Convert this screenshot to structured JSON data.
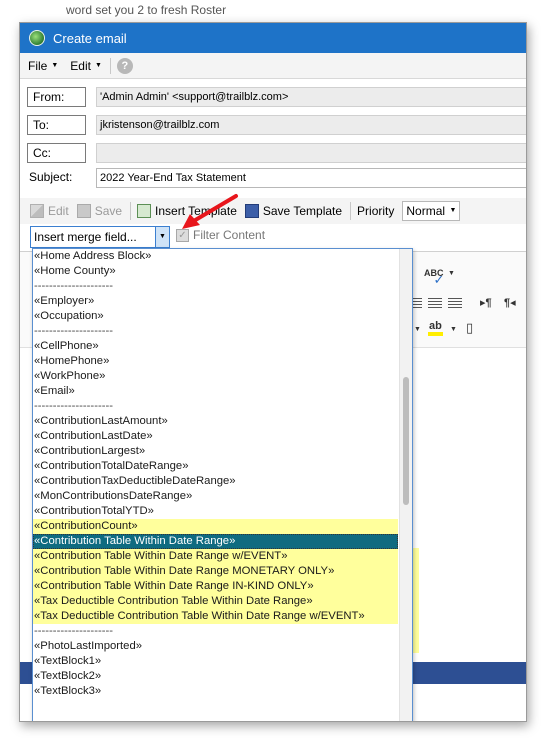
{
  "background": {
    "partial_text": "word set you 2 to fresh Roster"
  },
  "window": {
    "title": "Create email",
    "title_bar_color": "#1e73c8"
  },
  "menu": {
    "file_label": "File",
    "edit_label": "Edit",
    "help_icon": "help-icon"
  },
  "fields": {
    "from_label": "From:",
    "from_value": "'Admin Admin' <support@trailblz.com>",
    "to_label": "To:",
    "to_value": "jkristenson@trailblz.com",
    "cc_label": "Cc:",
    "cc_value": "",
    "subject_label": "Subject:",
    "subject_value": "2022 Year-End Tax Statement"
  },
  "toolbar": {
    "edit_label": "Edit",
    "save_label": "Save",
    "insert_template_label": "Insert Template",
    "save_template_label": "Save Template",
    "priority_label": "Priority",
    "priority_value": "Normal"
  },
  "merge": {
    "combo_value": "Insert merge field...",
    "filter_label": "Filter Content",
    "items": [
      "«Home Address Block»",
      "«Home County»",
      "---------------------",
      "«Employer»",
      "«Occupation»",
      "---------------------",
      "«CellPhone»",
      "«HomePhone»",
      "«WorkPhone»",
      "«Email»",
      "---------------------",
      "«ContributionLastAmount»",
      "«ContributionLastDate»",
      "«ContributionLargest»",
      "«ContributionTotalDateRange»",
      "«ContributionTaxDeductibleDateRange»",
      "«MonContributionsDateRange»",
      "«ContributionTotalYTD»",
      "«ContributionCount»",
      "«Contribution Table Within Date Range»",
      "«Contribution Table Within Date Range w/EVENT»",
      "«Contribution Table Within Date Range MONETARY ONLY»",
      "«Contribution Table Within Date Range IN-KIND ONLY»",
      "«Tax Deductible Contribution Table Within Date Range»",
      "«Tax Deductible Contribution Table Within Date Range w/EVENT»",
      "---------------------",
      "«PhotoLastImported»",
      "«TextBlock1»",
      "«TextBlock2»",
      "«TextBlock3»"
    ],
    "selected_index": 19,
    "highlight_color": "#ffff9c",
    "selected_color": "#0f6b80"
  },
  "annotation": {
    "arrow_color": "#e8161c"
  }
}
